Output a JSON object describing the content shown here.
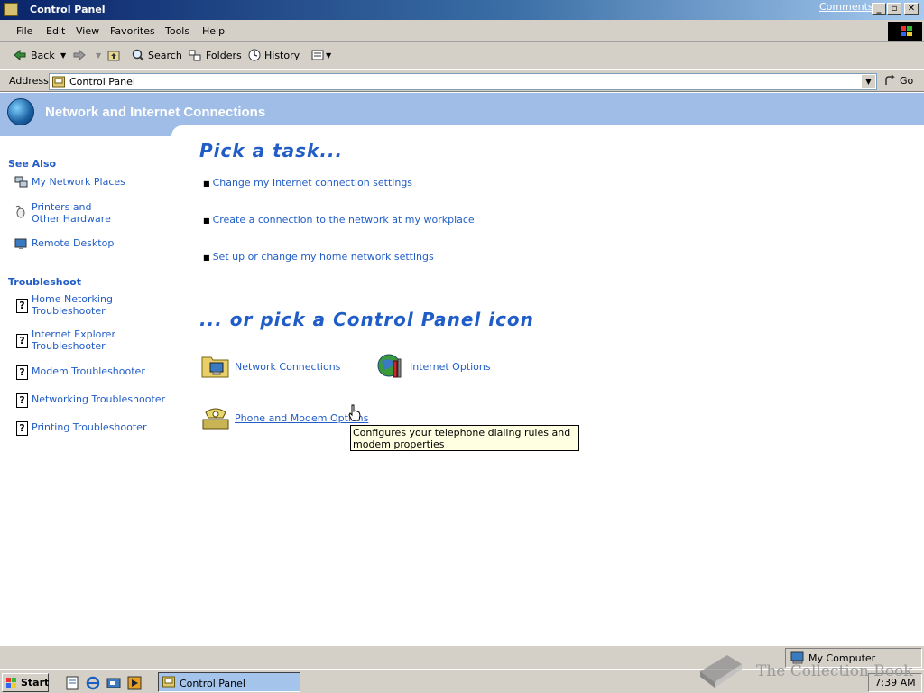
{
  "window": {
    "title": "Control Panel",
    "comments_link": "Comments?"
  },
  "menu": [
    "File",
    "Edit",
    "View",
    "Favorites",
    "Tools",
    "Help"
  ],
  "toolbar": {
    "back": "Back",
    "search": "Search",
    "folders": "Folders",
    "history": "History"
  },
  "address": {
    "label": "Address",
    "value": "Control Panel",
    "go": "Go"
  },
  "banner": {
    "title": "Network and Internet Connections"
  },
  "see_also": {
    "heading": "See Also",
    "items": [
      "My Network Places",
      "Printers and Other Hardware",
      "Remote Desktop"
    ]
  },
  "troubleshoot": {
    "heading": "Troubleshoot",
    "items": [
      "Home Netorking Troubleshooter",
      "Internet Explorer Troubleshooter",
      "Modem Troubleshooter",
      "Networking Troubleshooter",
      "Printing Troubleshooter"
    ]
  },
  "tasks": {
    "heading": "Pick a task...",
    "items": [
      "Change my Internet connection settings",
      "Create a connection to the network at my workplace",
      "Set up or change my home network settings"
    ]
  },
  "icons": {
    "heading": "... or pick a Control Panel icon",
    "items": [
      "Network Connections",
      "Internet Options",
      "Phone and Modem Options"
    ]
  },
  "tooltip": "Configures your telephone dialing rules and modem properties",
  "statusbar": {
    "location": "My Computer"
  },
  "taskbar": {
    "start": "Start",
    "task": "Control Panel",
    "clock": "7:39 AM"
  },
  "watermark": "The Collection Book",
  "colors": {
    "link_blue": "#215dc6",
    "banner": "#9fbde6",
    "title_bar": "#0a246a",
    "tooltip_bg": "#ffffe1"
  }
}
